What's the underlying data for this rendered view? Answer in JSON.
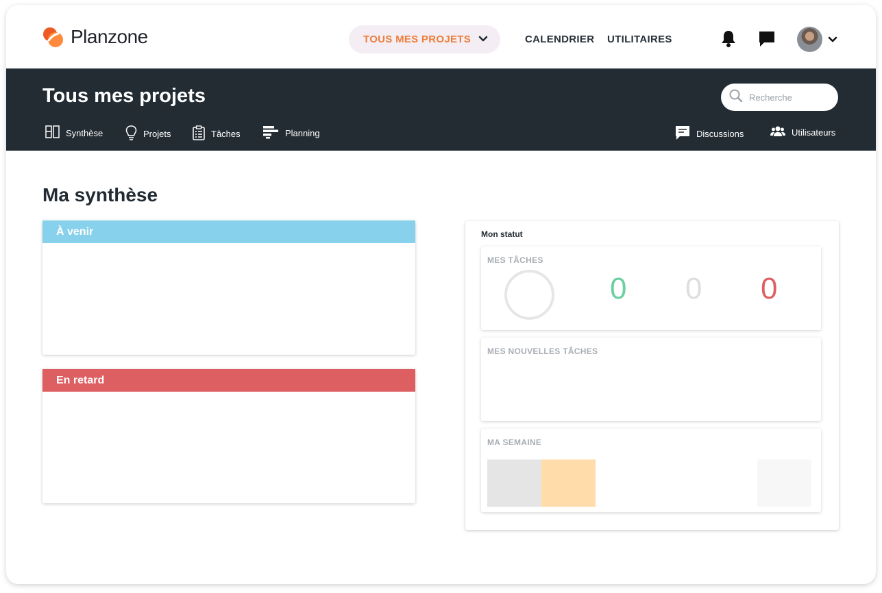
{
  "app": {
    "brand": "Planzone"
  },
  "header": {
    "projects_menu_label": "TOUS MES PROJETS",
    "nav": [
      {
        "label": "CALENDRIER"
      },
      {
        "label": "UTILITAIRES"
      }
    ]
  },
  "band": {
    "title": "Tous mes projets",
    "search_placeholder": "Recherche",
    "tabs": [
      {
        "label": "Synthèse",
        "icon": "layout-icon"
      },
      {
        "label": "Projets",
        "icon": "lightbulb-icon"
      },
      {
        "label": "Tâches",
        "icon": "clipboard-list-icon"
      },
      {
        "label": "Planning",
        "icon": "gantt-icon"
      }
    ],
    "right_tabs": [
      {
        "label": "Discussions",
        "icon": "chat-icon"
      },
      {
        "label": "Utilisateurs",
        "icon": "users-icon"
      }
    ]
  },
  "main": {
    "title": "Ma synthèse",
    "upcoming": {
      "title": "À venir",
      "color": "#87d1ec"
    },
    "late": {
      "title": "En retard",
      "color": "#de5f62"
    }
  },
  "status": {
    "title": "Mon statut",
    "tasks": {
      "title": "MES TÂCHES",
      "counts": [
        {
          "value": "0",
          "color": "#6dcea2"
        },
        {
          "value": "0",
          "color": "#dedede"
        },
        {
          "value": "0",
          "color": "#de5f62"
        }
      ]
    },
    "new_tasks": {
      "title": "MES NOUVELLES TÂCHES"
    },
    "week": {
      "title": "MA SEMAINE",
      "colors": [
        "#e5e5e5",
        "#ffdcaa",
        "#f7f7f7"
      ]
    }
  },
  "colors": {
    "accent": "#ee7d3b",
    "band": "#232c33"
  }
}
